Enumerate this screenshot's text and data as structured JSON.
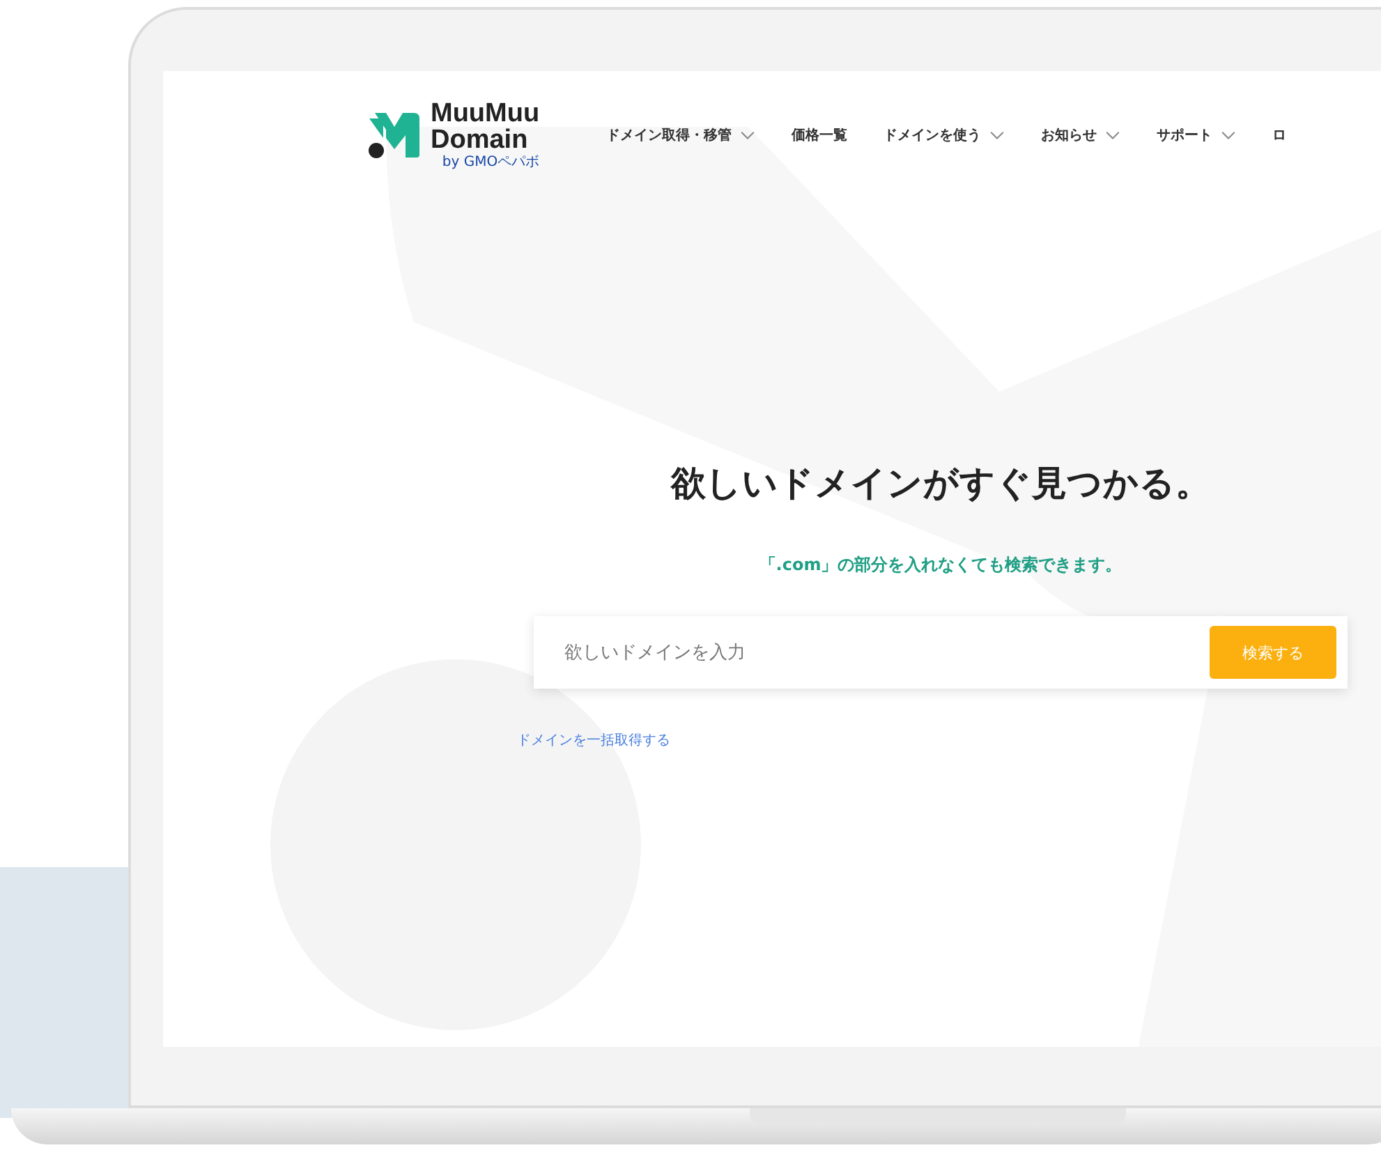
{
  "logo": {
    "line1": "MuuMuu",
    "line2": "Domain",
    "byline": "by GMOペパボ"
  },
  "nav": [
    {
      "label": "ドメイン取得・移管",
      "dropdown": true
    },
    {
      "label": "価格一覧",
      "dropdown": false
    },
    {
      "label": "ドメインを使う",
      "dropdown": true
    },
    {
      "label": "お知らせ",
      "dropdown": true
    },
    {
      "label": "サポート",
      "dropdown": true
    },
    {
      "label": "ロ",
      "dropdown": false
    }
  ],
  "hero": {
    "title": "欲しいドメインがすぐ見つかる。",
    "note": "「.com」の部分を入れなくても検索できます。"
  },
  "search": {
    "placeholder": "欲しいドメインを入力",
    "button": "検索する"
  },
  "bulk_link": "ドメインを一括取得する"
}
